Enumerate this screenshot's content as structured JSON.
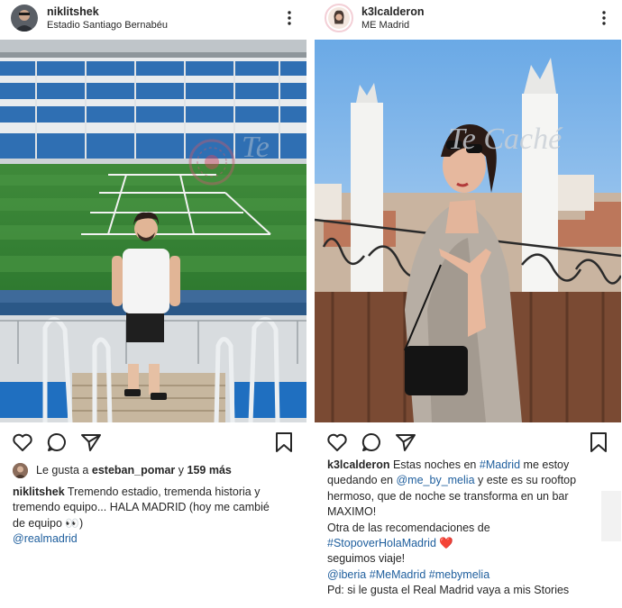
{
  "post_left": {
    "username": "niklitshek",
    "location": "Estadio Santiago Bernabéu",
    "likes": {
      "prefix": "Le gusta a",
      "user": "esteban_pomar",
      "joiner": "y",
      "count": "159 más"
    },
    "caption": {
      "user": "niklitshek",
      "line1": "Tremendo estadio, tremenda historia y",
      "line2": "tremendo equipo... HALA MADRID (hoy me cambié",
      "line3": "de equipo 👀)",
      "mention": "@realmadrid"
    }
  },
  "post_right": {
    "username": "k3lcalderon",
    "location": "ME Madrid",
    "watermark": "Te Caché",
    "caption": {
      "user": "k3lcalderon",
      "l1_a": "Estas noches en",
      "l1_tag": "#Madrid",
      "l1_b": "me estoy",
      "l2_a": "quedando en",
      "l2_tag": "@me_by_melia",
      "l2_b": "y este es su rooftop",
      "l3": "hermoso, que de noche se transforma en un bar",
      "l4": "MAXIMO!",
      "l5": "Otra de las recomendaciones de",
      "l6_tag": "#StopoverHolaMadrid",
      "l6_heart": "❤️",
      "l7": "seguimos viaje!",
      "l8_t1": "@iberia",
      "l8_t2": "#MeMadrid",
      "l8_t3": "#mebymelia",
      "l9": "Pd: si le gusta el Real Madrid vaya a mis Stories"
    }
  },
  "icons": {
    "more": "more-vertical-icon",
    "like": "heart-outline-icon",
    "comment": "comment-bubble-icon",
    "share": "paper-plane-icon",
    "save": "bookmark-icon"
  },
  "colors": {
    "text": "#262626",
    "link": "#1e5e9d",
    "heart": "#e0313f"
  }
}
